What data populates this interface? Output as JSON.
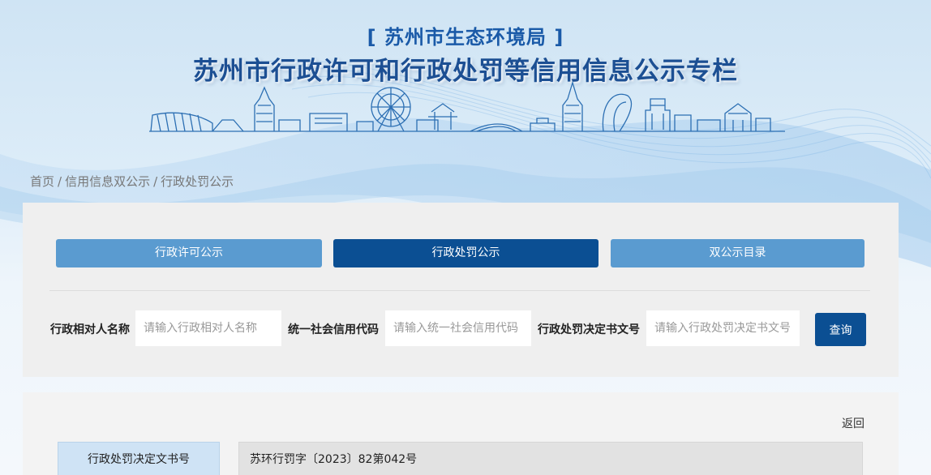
{
  "header": {
    "agency": "[ 苏州市生态环境局 ]",
    "title": "苏州市行政许可和行政处罚等信用信息公示专栏"
  },
  "breadcrumb": {
    "home": "首页",
    "section": "信用信息双公示",
    "current": "行政处罚公示",
    "separator": "/"
  },
  "tabs": [
    {
      "label": "行政许可公示",
      "active": false
    },
    {
      "label": "行政处罚公示",
      "active": true
    },
    {
      "label": "双公示目录",
      "active": false
    }
  ],
  "search": {
    "party_name_label": "行政相对人名称",
    "party_name_placeholder": "请输入行政相对人名称",
    "credit_code_label": "统一社会信用代码",
    "credit_code_placeholder": "请输入统一社会信用代码",
    "doc_no_label": "行政处罚决定书文号",
    "doc_no_placeholder": "请输入行政处罚决定书文号",
    "query_label": "查询"
  },
  "detail": {
    "back_label": "返回",
    "rows": [
      {
        "label": "行政处罚决定文书号",
        "value": "苏环行罚字〔2023〕82第042号"
      }
    ]
  },
  "colors": {
    "accent_dark": "#0b4f93",
    "accent_light": "#5a9bd0",
    "title_blue": "#1c4f93"
  }
}
